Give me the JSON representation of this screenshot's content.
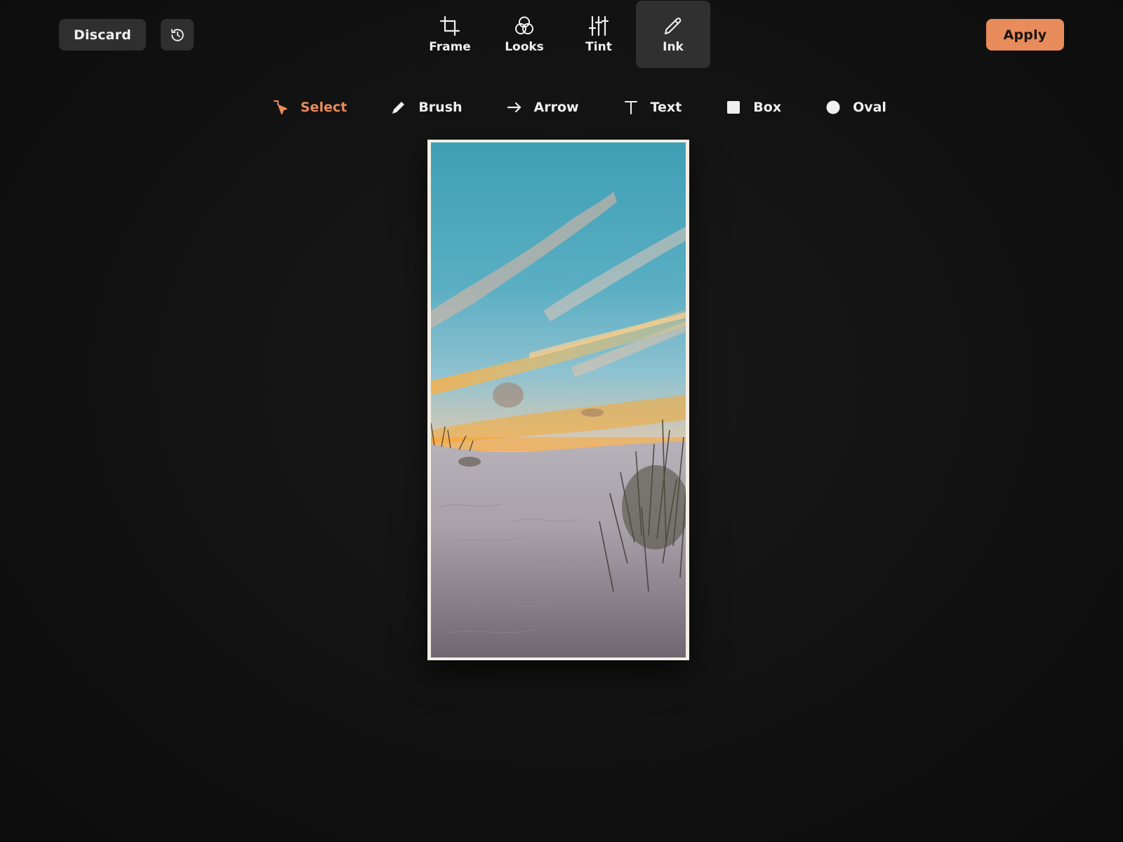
{
  "toolbar": {
    "discard_label": "Discard",
    "apply_label": "Apply",
    "history_icon": "history-icon"
  },
  "modes": [
    {
      "label": "Frame",
      "icon": "crop-icon",
      "active": false
    },
    {
      "label": "Looks",
      "icon": "filters-icon",
      "active": false
    },
    {
      "label": "Tint",
      "icon": "sliders-icon",
      "active": false
    },
    {
      "label": "Ink",
      "icon": "pencil-icon",
      "active": true
    }
  ],
  "tools": [
    {
      "label": "Select",
      "icon": "select-pointer-icon",
      "active": true
    },
    {
      "label": "Brush",
      "icon": "brush-icon",
      "active": false
    },
    {
      "label": "Arrow",
      "icon": "arrow-right-icon",
      "active": false
    },
    {
      "label": "Text",
      "icon": "text-icon",
      "active": false
    },
    {
      "label": "Box",
      "icon": "square-icon",
      "active": false
    },
    {
      "label": "Oval",
      "icon": "circle-icon",
      "active": false
    }
  ],
  "colors": {
    "accent": "#e88c5b",
    "background": "#121212",
    "button_bg": "#2f2f2f",
    "active_tab_bg": "#303030",
    "photo_border": "#f3eee4"
  },
  "canvas": {
    "image": "sunset-beach-dunes-photo"
  }
}
